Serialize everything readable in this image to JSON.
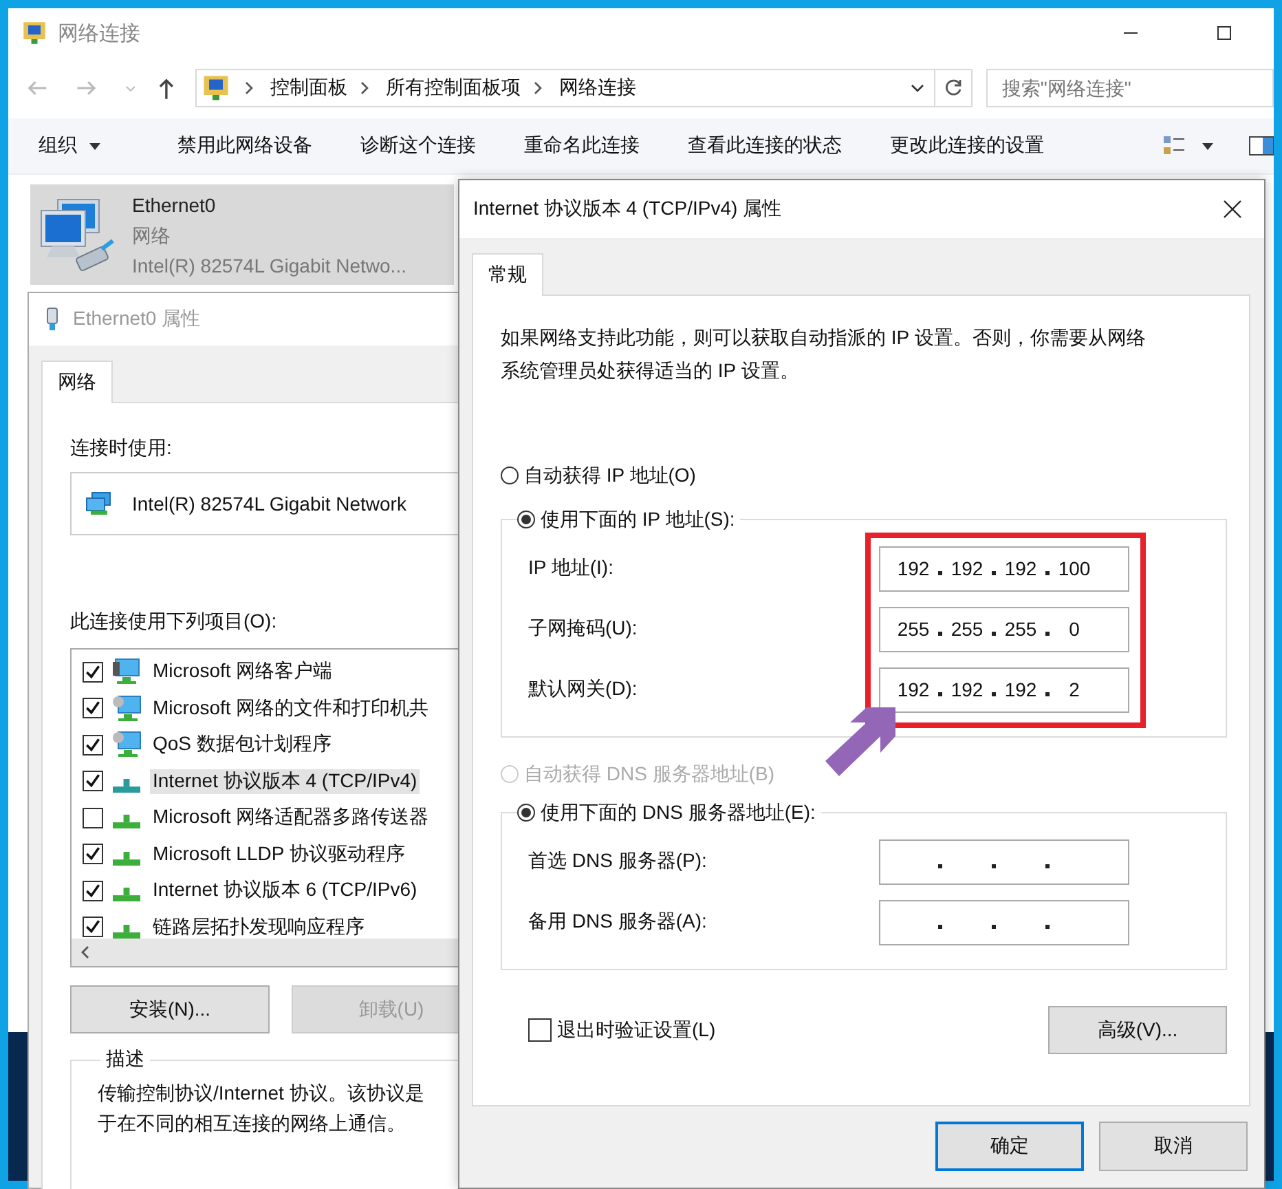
{
  "explorer": {
    "title": "网络连接",
    "breadcrumbs": [
      "控制面板",
      "所有控制面板项",
      "网络连接"
    ],
    "search": {
      "placeholder": "搜索\"网络连接\""
    },
    "toolbar": [
      {
        "label": "组织",
        "kind": "menu"
      },
      {
        "label": "禁用此网络设备",
        "kind": "command"
      },
      {
        "label": "诊断这个连接",
        "kind": "command"
      },
      {
        "label": "重命名此连接",
        "kind": "command"
      },
      {
        "label": "查看此连接的状态",
        "kind": "command"
      },
      {
        "label": "更改此连接的设置",
        "kind": "command"
      }
    ],
    "connection": {
      "name": "Ethernet0",
      "network": "网络",
      "adapter": "Intel(R) 82574L Gigabit Netwo...",
      "selected": true
    }
  },
  "ethernet_properties": {
    "title": "Ethernet0 属性",
    "tabs": [
      {
        "label": "网络",
        "selected": true
      }
    ],
    "connect_using_label": "连接时使用:",
    "adapter": "Intel(R) 82574L Gigabit Network",
    "items_label": "此连接使用下列项目(O):",
    "items": [
      {
        "label": "Microsoft 网络客户端",
        "kind": "client",
        "checked": true,
        "selected": false
      },
      {
        "label": "Microsoft 网络的文件和打印机共",
        "kind": "service",
        "checked": true,
        "selected": false
      },
      {
        "label": "QoS 数据包计划程序",
        "kind": "service",
        "checked": true,
        "selected": false
      },
      {
        "label": "Internet 协议版本 4 (TCP/IPv4)",
        "kind": "protocol",
        "checked": true,
        "selected": true
      },
      {
        "label": "Microsoft 网络适配器多路传送器",
        "kind": "protocol",
        "checked": false,
        "selected": false
      },
      {
        "label": "Microsoft LLDP 协议驱动程序",
        "kind": "protocol",
        "checked": true,
        "selected": false
      },
      {
        "label": "Internet 协议版本 6 (TCP/IPv6)",
        "kind": "protocol",
        "checked": true,
        "selected": false
      },
      {
        "label": "链路层拓扑发现响应程序",
        "kind": "protocol",
        "checked": true,
        "selected": false
      }
    ],
    "buttons": [
      {
        "label": "安装(N)...",
        "disabled": false
      },
      {
        "label": "卸载(U)",
        "disabled": true
      }
    ],
    "description": {
      "title": "描述",
      "lines": [
        "传输控制协议/Internet 协议。该协议是",
        "于在不同的相互连接的网络上通信。"
      ]
    }
  },
  "ipv4_properties": {
    "title": "Internet 协议版本 4 (TCP/IPv4) 属性",
    "tabs": [
      {
        "label": "常规",
        "selected": true
      }
    ],
    "intro": "如果网络支持此功能，则可以获取自动指派的 IP 设置。否则，你需要从网络系统管理员处获得适当的 IP 设置。",
    "ip_auto": {
      "label": "自动获得 IP 地址(O)",
      "selected": false,
      "disabled": false
    },
    "ip_manual": {
      "label": "使用下面的 IP 地址(S):",
      "selected": true,
      "disabled": false
    },
    "ip_fields": [
      {
        "label": "IP 地址(I):",
        "octets": [
          "192",
          "192",
          "192",
          "100"
        ]
      },
      {
        "label": "子网掩码(U):",
        "octets": [
          "255",
          "255",
          "255",
          "0"
        ]
      },
      {
        "label": "默认网关(D):",
        "octets": [
          "192",
          "192",
          "192",
          "2"
        ]
      }
    ],
    "dns_auto": {
      "label": "自动获得 DNS 服务器地址(B)",
      "selected": false,
      "disabled": true
    },
    "dns_manual": {
      "label": "使用下面的 DNS 服务器地址(E):",
      "selected": true,
      "disabled": false
    },
    "dns_fields": [
      {
        "label": "首选 DNS 服务器(P):"
      },
      {
        "label": "备用 DNS 服务器(A):"
      }
    ],
    "validate": {
      "label": "退出时验证设置(L)",
      "checked": false
    },
    "advanced_button": "高级(V)...",
    "buttons": [
      {
        "label": "确定",
        "default": true
      },
      {
        "label": "取消",
        "default": false
      }
    ]
  },
  "annotations": [
    {
      "kind": "highlight-box"
    },
    {
      "kind": "arrow"
    }
  ]
}
